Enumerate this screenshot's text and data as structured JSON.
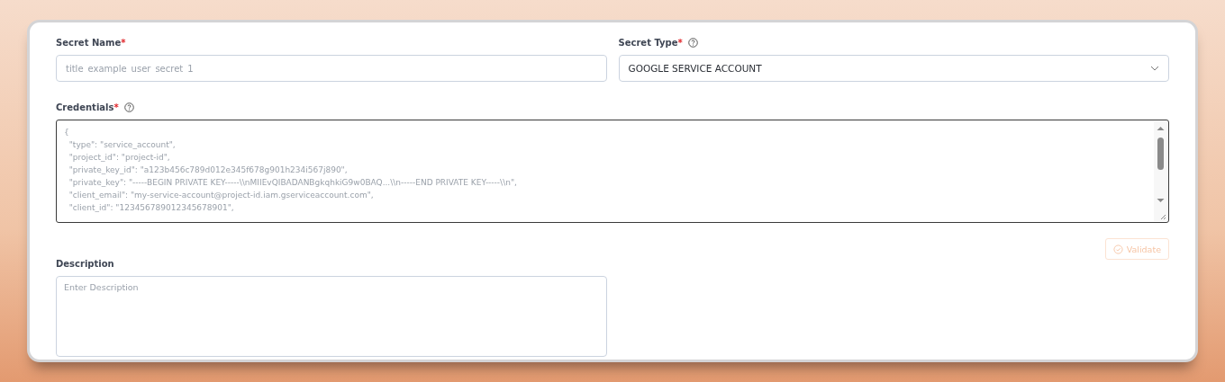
{
  "secret_name": {
    "label": "Secret Name",
    "required_mark": "*",
    "placeholder": "title_example_user_secret_1"
  },
  "secret_type": {
    "label": "Secret Type",
    "required_mark": "*",
    "value": "GOOGLE SERVICE ACCOUNT"
  },
  "credentials": {
    "label": "Credentials",
    "required_mark": "*",
    "lines": [
      "{",
      "  \"type\": \"service_account\",",
      "  \"project_id\": \"project-id\",",
      "  \"private_key_id\": \"a123b456c789d012e345f678g901h234i567j890\",",
      "  \"private_key\": \"-----BEGIN PRIVATE KEY-----\\\\nMIIEvQIBADANBgkqhkiG9w0BAQ...\\\\n-----END PRIVATE KEY-----\\\\n\",",
      "  \"client_email\": \"my-service-account@project-id.iam.gserviceaccount.com\",",
      "  \"client_id\": \"123456789012345678901\","
    ]
  },
  "validate_button": {
    "label": "Validate",
    "disabled": true
  },
  "description": {
    "label": "Description",
    "placeholder": "Enter Description"
  }
}
